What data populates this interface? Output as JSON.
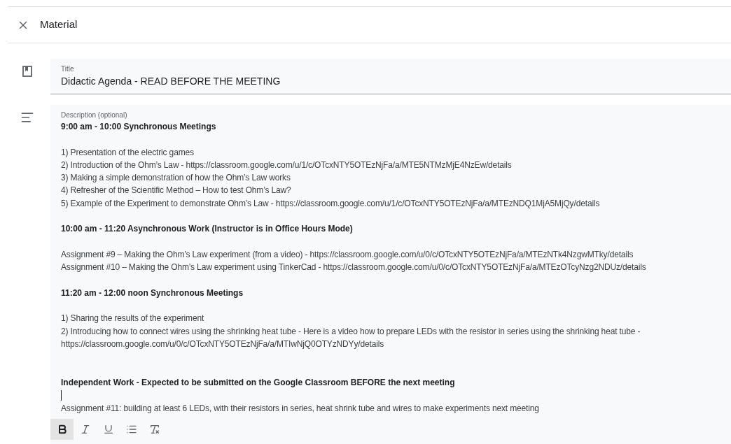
{
  "header": {
    "title": "Material"
  },
  "title_field": {
    "label": "Title",
    "value": "Didactic Agenda - READ BEFORE THE MEETING"
  },
  "description_field": {
    "label": "Description (optional)",
    "lines": [
      {
        "kind": "bold",
        "text": "9:00 am - 10:00 Synchronous Meetings"
      },
      {
        "kind": "blank"
      },
      {
        "kind": "normal",
        "text": "1) Presentation of the electric games"
      },
      {
        "kind": "normal",
        "text": "2) Introduction of the Ohm’s Law - https://classroom.google.com/u/1/c/OTcxNTY5OTEzNjFa/a/MTE5NTMzMjE4NzEw/details"
      },
      {
        "kind": "normal",
        "text": "3) Making a simple demonstration of how the Ohm’s Law works"
      },
      {
        "kind": "normal",
        "text": "4) Refresher of the Scientific Method – How to test Ohm’s Law?"
      },
      {
        "kind": "normal",
        "text": "5) Example of the Experiment to demonstrate Ohm’s Law - https://classroom.google.com/u/1/c/OTcxNTY5OTEzNjFa/a/MTEzNDQ1MjA5MjQy/details"
      },
      {
        "kind": "blank"
      },
      {
        "kind": "bold",
        "text": "10:00 am - 11:20 Asynchronous Work (Instructor is in Office Hours Mode)"
      },
      {
        "kind": "blank"
      },
      {
        "kind": "normal",
        "text": "Assignment #9 – Making the Ohm’s Law experiment (from a video) - https://classroom.google.com/u/0/c/OTcxNTY5OTEzNjFa/a/MTEzNTk4NzgwMTky/details"
      },
      {
        "kind": "normal",
        "text": "Assignment #10 – Making the Ohm’s Law experiment using TinkerCad - https://classroom.google.com/u/0/c/OTcxNTY5OTEzNjFa/a/MTEzOTcyNzg2NDUz/details"
      },
      {
        "kind": "blank"
      },
      {
        "kind": "bold",
        "text": "11:20 am - 12:00 noon Synchronous Meetings"
      },
      {
        "kind": "blank"
      },
      {
        "kind": "normal",
        "text": "1) Sharing the results of the experiment"
      },
      {
        "kind": "normal",
        "text": "2) Introducing how to connect wires using the shrinking heat tube - Here is a video how to prepare LEDs with the resistor in series using the shrinking heat tube -"
      },
      {
        "kind": "normal",
        "text": "https://classroom.google.com/u/0/c/OTcxNTY5OTEzNjFa/a/MTIwNjQ0OTYzNDYy/details"
      },
      {
        "kind": "blank"
      },
      {
        "kind": "blank"
      },
      {
        "kind": "bold",
        "text": "Independent Work - Expected to be submitted on the Google Classroom BEFORE the next meeting"
      },
      {
        "kind": "caret"
      },
      {
        "kind": "normal",
        "text": "Assignment #11: building at least 6 LEDs, with their resistors in series, heat shrink tube and wires to make experiments next meeting"
      }
    ]
  },
  "toolbar": [
    {
      "kind": "bold",
      "selected": true
    },
    {
      "kind": "italic",
      "selected": false
    },
    {
      "kind": "underline",
      "selected": false
    },
    {
      "kind": "bulleted-list",
      "selected": false
    },
    {
      "kind": "clear-formatting",
      "selected": false
    }
  ]
}
